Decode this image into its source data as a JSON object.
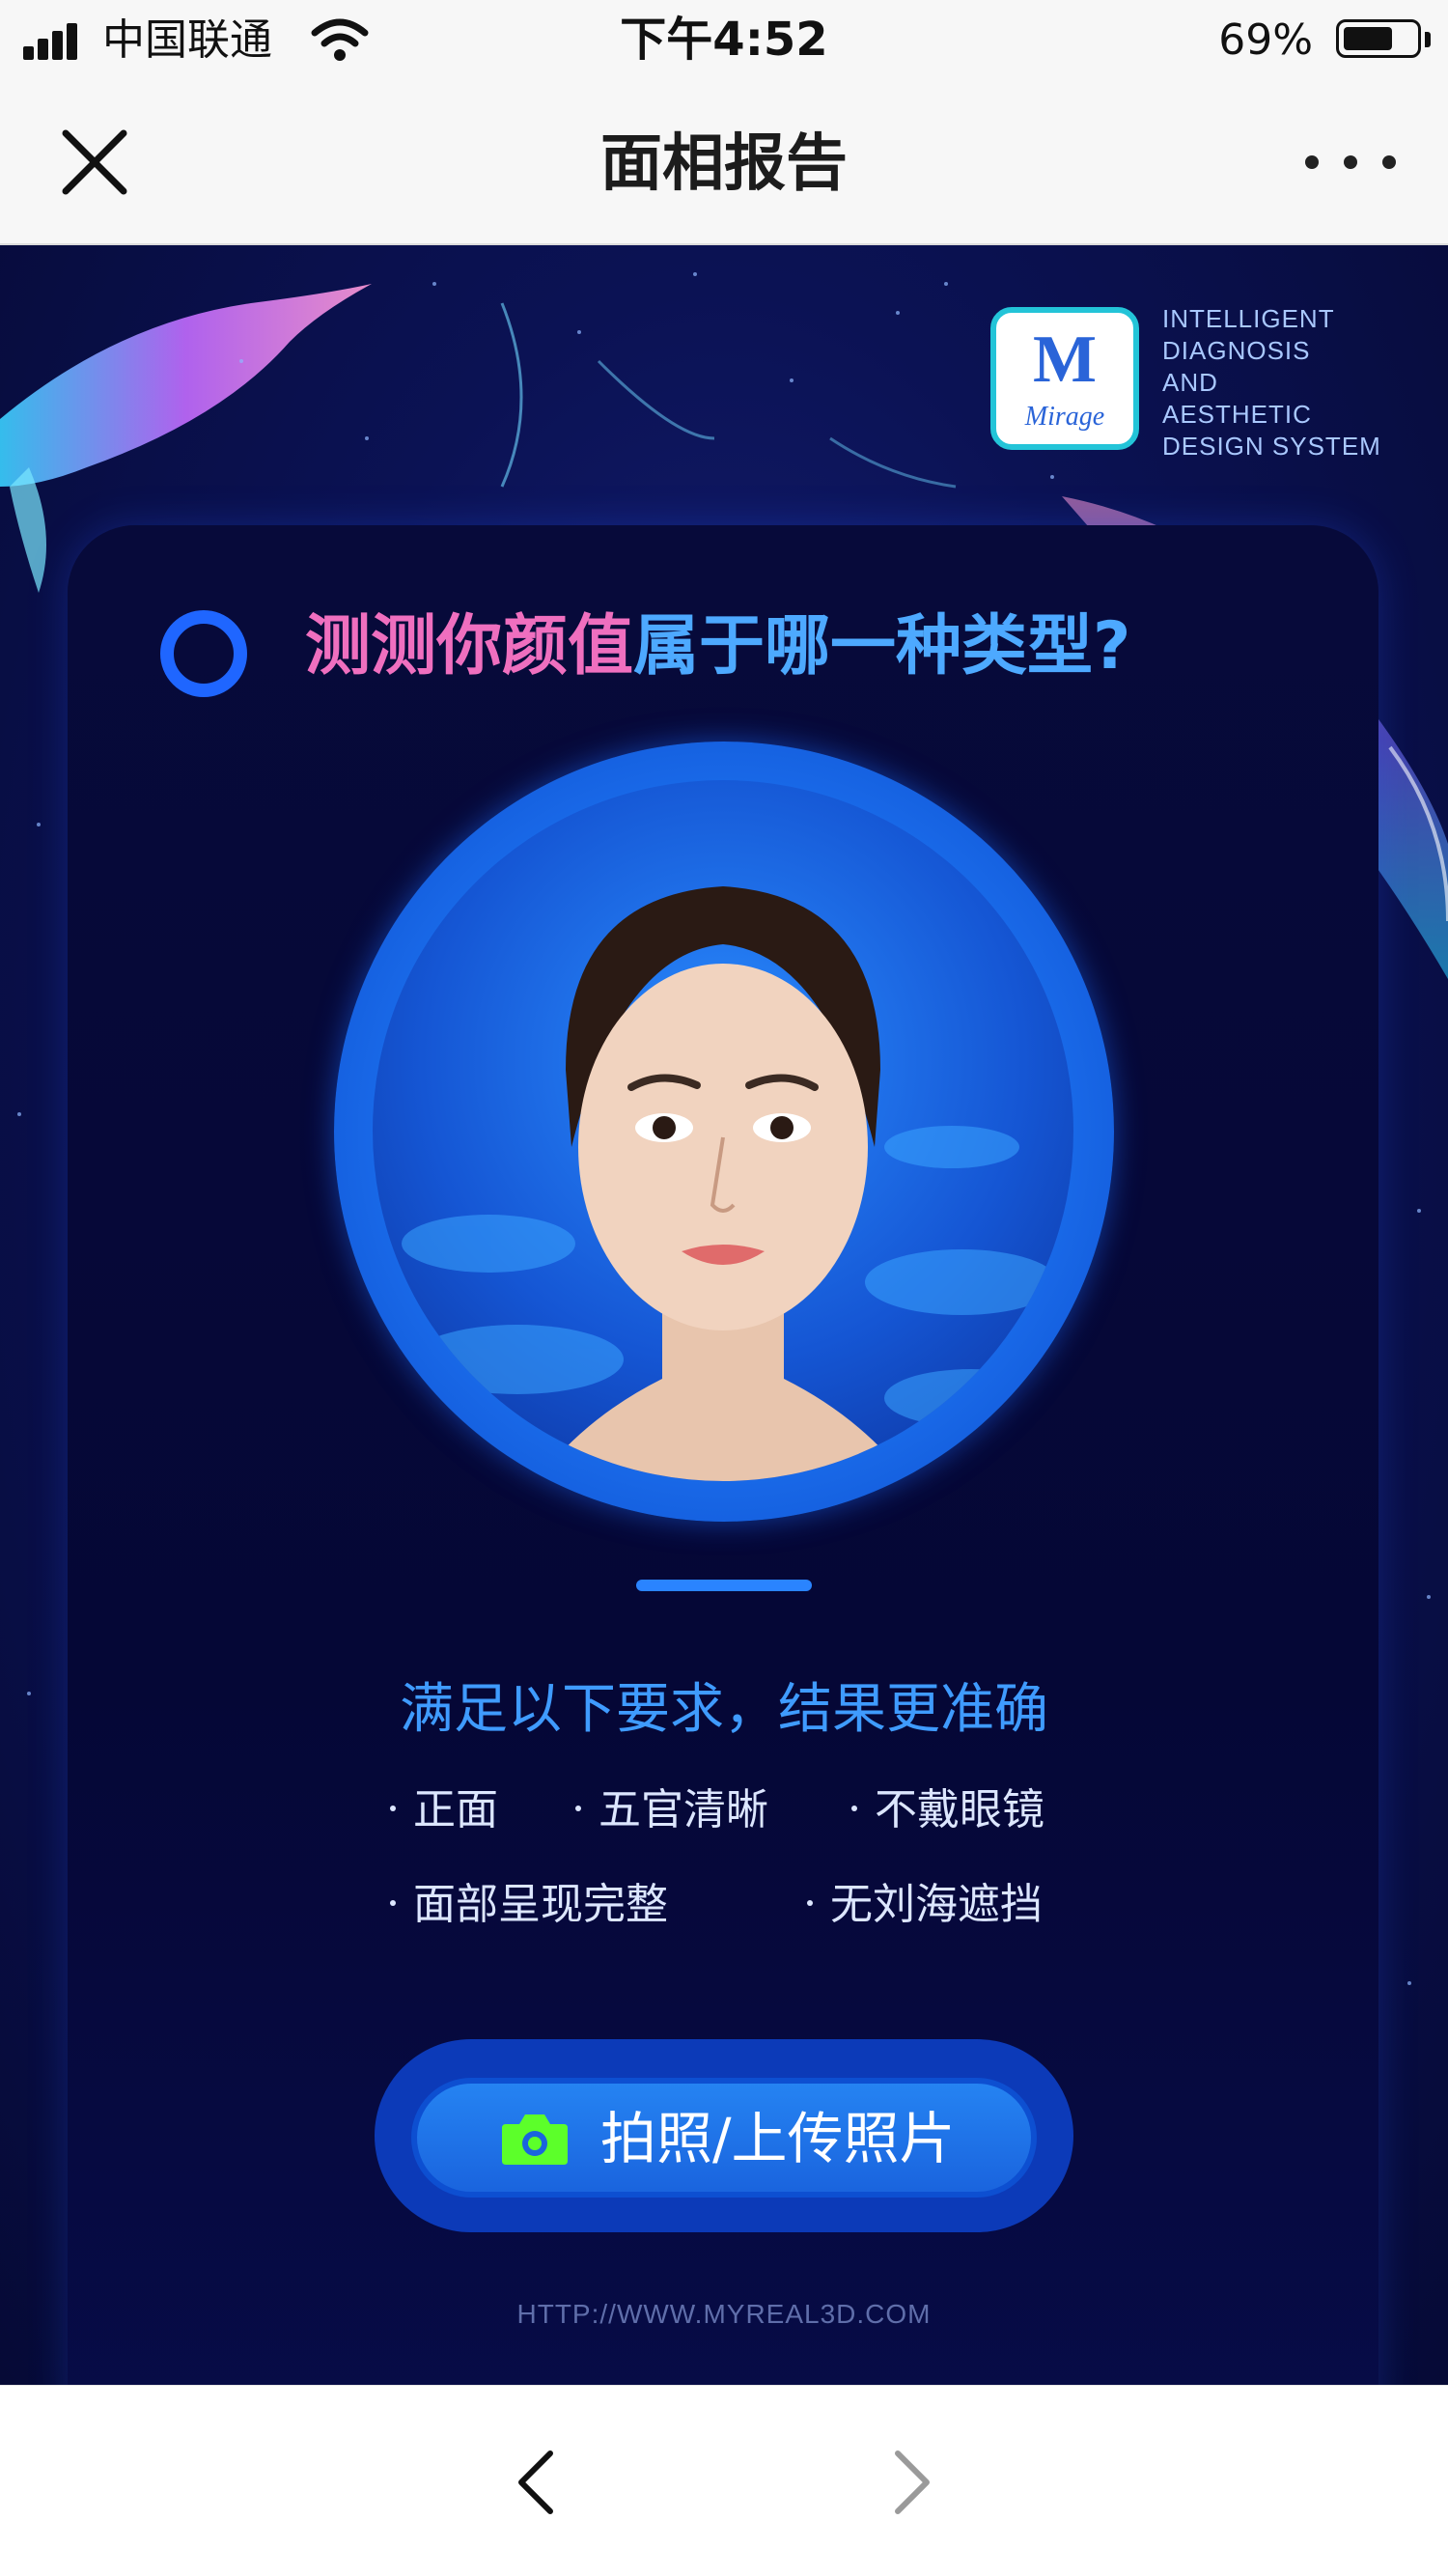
{
  "status_bar": {
    "carrier": "中国联通",
    "time": "下午4:52",
    "battery_percent": "69%",
    "battery_level": 0.69
  },
  "nav": {
    "title": "面相报告",
    "close_icon": "close-icon",
    "more_icon": "more-icon"
  },
  "banner": {
    "logo_word": "Mirage",
    "logo_letter": "M",
    "tagline_lines": [
      "INTELLIGENT",
      "DIAGNOSIS",
      "AND",
      "AESTHETIC",
      "DESIGN SYSTEM"
    ]
  },
  "main": {
    "headline_part1": "测测你颜值",
    "headline_part2": "属于哪一种类型?",
    "requirements_title": "满足以下要求，结果更准确",
    "requirements": [
      "正面",
      "五官清晰",
      "不戴眼镜",
      "面部呈现完整",
      "无刘海遮挡"
    ],
    "upload_label": "拍照/上传照片",
    "upload_icon": "camera-icon",
    "site_url": "HTTP://WWW.MYREAL3D.COM"
  },
  "toolbar": {
    "back_icon": "chevron-left-icon",
    "forward_icon": "chevron-right-icon"
  },
  "colors": {
    "headline_pink": "#ef6fbf",
    "headline_blue": "#4da9ff",
    "accent_blue": "#1a64de",
    "camera_green": "#5cff2a",
    "background_navy": "#060a36"
  }
}
